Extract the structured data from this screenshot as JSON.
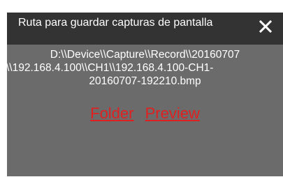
{
  "dialog": {
    "title": "Ruta para guardar capturas de pantalla",
    "close_icon": "close-icon",
    "path_lines": [
      "D:\\\\Device\\\\Capture\\\\Record\\\\20160707",
      "\\\\192.168.4.100\\\\CH1\\\\192.168.4.100-CH1-",
      "20160707-192210.bmp"
    ],
    "links": {
      "folder": "Folder",
      "preview": "Preview"
    },
    "colors": {
      "background": "#6b6b6b",
      "title_bar": "#333333",
      "text": "#ffffff",
      "link": "#e02020"
    }
  }
}
